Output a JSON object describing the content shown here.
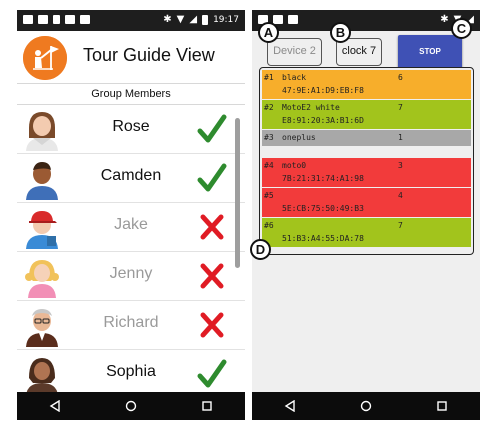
{
  "left_screen": {
    "status_bar": {
      "time": "19:17"
    },
    "header": {
      "title": "Tour Guide View",
      "logo_icon": "tour-guide-flag-logo-icon",
      "logo_color": "#ef7a20"
    },
    "group_members_label": "Group Members",
    "members": [
      {
        "name": "Rose",
        "present": true
      },
      {
        "name": "Camden",
        "present": true
      },
      {
        "name": "Jake",
        "present": false
      },
      {
        "name": "Jenny",
        "present": false
      },
      {
        "name": "Richard",
        "present": false
      },
      {
        "name": "Sophia",
        "present": true
      }
    ],
    "status_colors": {
      "present": "#2e8b2e",
      "absent": "#e01b24"
    }
  },
  "right_screen": {
    "device_button": "Device 2",
    "clock_button": "clock 7",
    "stop_button": "STOP",
    "stop_color": "#3f51b5",
    "devices": [
      {
        "id": "#1",
        "name": "black",
        "count": "6",
        "mac": "47:9E:A1:D9:EB:F8",
        "color": "#f7ae2b"
      },
      {
        "id": "#2",
        "name": "MotoE2 white",
        "count": "7",
        "mac": "E8:91:20:3A:B1:6D",
        "color": "#a2c41c"
      },
      {
        "id": "#3",
        "name": "oneplus",
        "count": "1",
        "mac": "",
        "color": "#a8a8a8"
      },
      {
        "id": "#4",
        "name": "moto0",
        "count": "3",
        "mac": "7B:21:31:74:A1:98",
        "color": "#f23b3b"
      },
      {
        "id": "#5",
        "name": "",
        "count": "4",
        "mac": "5E:CB:75:50:49:B3",
        "color": "#f23b3b"
      },
      {
        "id": "#6",
        "name": "",
        "count": "7",
        "mac": "51:B3:A4:55:DA:78",
        "color": "#a2c41c"
      }
    ]
  },
  "callouts": {
    "a": "A",
    "b": "B",
    "c": "C",
    "d": "D"
  }
}
